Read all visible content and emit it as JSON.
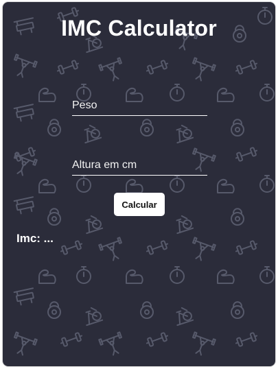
{
  "app": {
    "title": "IMC Calculator"
  },
  "form": {
    "peso_placeholder": "Peso",
    "altura_placeholder": "Altura em cm",
    "calculate_label": "Calcular"
  },
  "result": {
    "text": "Imc: ..."
  },
  "colors": {
    "background": "#2b2c3a",
    "pattern_icons": "#575a6b",
    "text": "#ffffff",
    "button_bg": "#ffffff"
  },
  "icons": {
    "background_pattern": [
      "dumbbell-icon",
      "kettlebell-icon",
      "stopwatch-icon",
      "flexed-arm-icon",
      "exercise-bike-icon",
      "weightlifter-icon",
      "bench-press-icon"
    ]
  }
}
